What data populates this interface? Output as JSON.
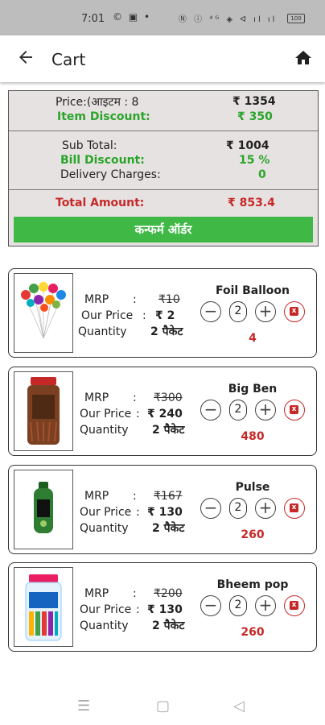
{
  "status": {
    "time": "7:01",
    "icons": "© ▣ •",
    "right": "Ⓝ ⓘ ⁴ᴳ ◈ ᐊ ıl ıl",
    "battery": "100"
  },
  "appbar": {
    "title": "Cart"
  },
  "summary": {
    "price_label": "Price:(आइटम : 8",
    "price_value": "₹ 1354",
    "item_discount_label": "Item Discount:",
    "item_discount_value": "₹ 350",
    "subtotal_label": "Sub Total:",
    "subtotal_value": "₹ 1004",
    "bill_discount_label": "Bill Discount:",
    "bill_discount_value": "15 %",
    "delivery_label": "Delivery Charges:",
    "delivery_value": "0",
    "total_label": "Total Amount:",
    "total_value": "₹ 853.4",
    "confirm_label": "कन्फर्म ऑर्डर"
  },
  "labels": {
    "mrp": "MRP",
    "our_price": "Our Price",
    "quantity": "Quantity",
    "colon": ":"
  },
  "items": [
    {
      "name": "Foil Balloon",
      "mrp": "₹10",
      "price": "₹ 2",
      "quantity": "2 पैकेट",
      "count": "2",
      "total": "4"
    },
    {
      "name": "Big Ben",
      "mrp": "₹300",
      "price": "₹ 240",
      "quantity": "2 पैकेट",
      "count": "2",
      "total": "480"
    },
    {
      "name": "Pulse",
      "mrp": "₹167",
      "price": "₹ 130",
      "quantity": "2 पैकेट",
      "count": "2",
      "total": "260"
    },
    {
      "name": "Bheem pop",
      "mrp": "₹200",
      "price": "₹ 130",
      "quantity": "2 पैकेट",
      "count": "2",
      "total": "260"
    }
  ],
  "controls": {
    "minus": "−",
    "plus": "+",
    "delete": "x"
  },
  "nav": {
    "menu": "☰",
    "home": "▢",
    "back": "◁"
  }
}
